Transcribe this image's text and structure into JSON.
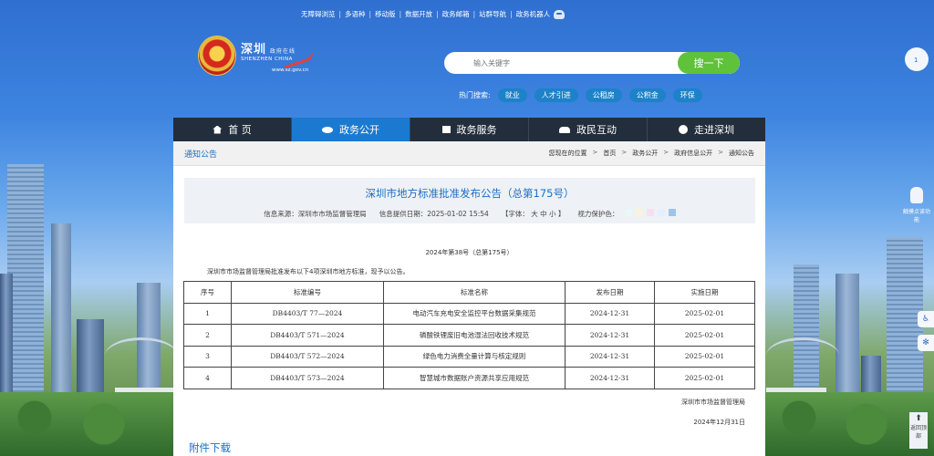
{
  "top_links": [
    "无障碍浏览",
    "多语种",
    "移动版",
    "数据开放",
    "政务邮箱",
    "站群导航",
    "政务机器人"
  ],
  "logo": {
    "cn": "深圳",
    "cn_small": "政府在线",
    "en": "SHENZHEN CHINA",
    "url": "www.sz.gov.cn"
  },
  "search": {
    "placeholder": "输入关键字",
    "button": "搜一下"
  },
  "hot": {
    "label": "热门搜索:",
    "tags": [
      "就业",
      "人才引进",
      "公租房",
      "公积金",
      "环保"
    ]
  },
  "nav": [
    "首 页",
    "政务公开",
    "政务服务",
    "政民互动",
    "走进深圳"
  ],
  "breadcrumb": {
    "section": "通知公告",
    "path": [
      "您现在的位置",
      "首页",
      "政务公开",
      "政府信息公开",
      "通知公告"
    ]
  },
  "article": {
    "title": "深圳市地方标准批准发布公告（总第175号）",
    "source": "信息来源：深圳市市场监督管理局",
    "date": "信息提供日期：2025-01-02 15:54",
    "font": "【字体：  大  中  小  】",
    "eye": "视力保护色：",
    "eye_colors": [
      "#e8f7f7",
      "#f8f4dc",
      "#f7dff3",
      "#e6efff",
      "#9fc4ea"
    ],
    "subtitle": "2024年第38号（总第175号）",
    "intro": "深圳市市场监督管理局批准发布以下4项深圳市地方标准，现予以公告。",
    "table": {
      "headers": [
        "序号",
        "标准编号",
        "标准名称",
        "发布日期",
        "实施日期"
      ],
      "rows": [
        [
          "1",
          "DB4403/T 77—2024",
          "电动汽车充电安全监控平台数据采集规范",
          "2024-12-31",
          "2025-02-01"
        ],
        [
          "2",
          "DB4403/T 571—2024",
          "磷酸铁锂废旧电池湿法回收技术规范",
          "2024-12-31",
          "2025-02-01"
        ],
        [
          "3",
          "DB4403/T 572—2024",
          "绿色电力消费全量计算与核定规则",
          "2024-12-31",
          "2025-02-01"
        ],
        [
          "4",
          "DB4403/T 573—2024",
          "智慧城市数据账户资源共享应用规范",
          "2024-12-31",
          "2025-02-01"
        ]
      ]
    },
    "signature": "深圳市市场监督管理局",
    "sign_date": "2024年12月31日",
    "attachment": "附件下载"
  },
  "side": {
    "hand_label": "触摸点读功能",
    "top_label": "返回顶部"
  },
  "colors": {
    "nav_bg": "#222e3c",
    "nav_active": "#1b7ad0",
    "search_btn": "#5fc23a",
    "link_blue": "#1b6fc8"
  }
}
